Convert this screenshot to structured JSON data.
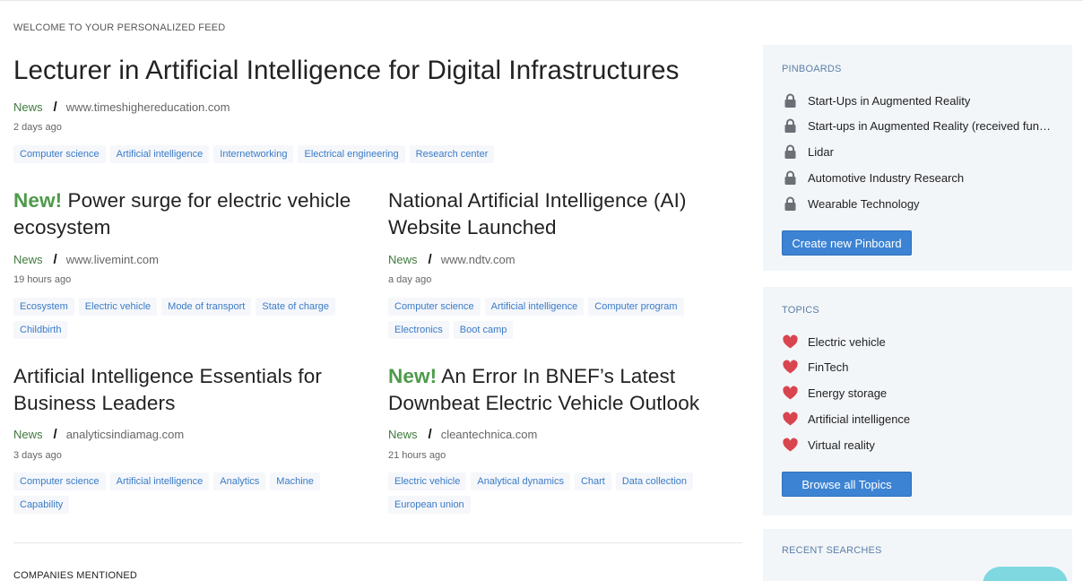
{
  "feed": {
    "welcome": "WELCOME TO YOUR PERSONALIZED FEED",
    "lead": {
      "title": "Lecturer in Artificial Intelligence for Digital Infrastructures",
      "type": "News",
      "source": "www.timeshighereducation.com",
      "age": "2 days ago",
      "tags": [
        "Computer science",
        "Artificial intelligence",
        "Internetworking",
        "Electrical engineering",
        "Research center"
      ]
    },
    "cards": [
      {
        "new_label": "New!",
        "title": "Power surge for electric vehicle ecosystem",
        "type": "News",
        "source": "www.livemint.com",
        "age": "19 hours ago",
        "tags": [
          "Ecosystem",
          "Electric vehicle",
          "Mode of transport",
          "State of charge",
          "Childbirth"
        ]
      },
      {
        "new_label": "",
        "title": "National Artificial Intelligence (AI) Website Launched",
        "type": "News",
        "source": "www.ndtv.com",
        "age": "a day ago",
        "tags": [
          "Computer science",
          "Artificial intelligence",
          "Computer program",
          "Electronics",
          "Boot camp"
        ]
      },
      {
        "new_label": "",
        "title": "Artificial Intelligence Essentials for Business Leaders",
        "type": "News",
        "source": "analyticsindiamag.com",
        "age": "3 days ago",
        "tags": [
          "Computer science",
          "Artificial intelligence",
          "Analytics",
          "Machine",
          "Capability"
        ]
      },
      {
        "new_label": "New!",
        "title": "An Error In BNEF’s Latest Downbeat Electric Vehicle Outlook",
        "type": "News",
        "source": "cleantechnica.com",
        "age": "21 hours ago",
        "tags": [
          "Electric vehicle",
          "Analytical dynamics",
          "Chart",
          "Data collection",
          "European union"
        ]
      }
    ],
    "companies_heading": "COMPANIES MENTIONED"
  },
  "sidebar": {
    "pinboards": {
      "title": "PINBOARDS",
      "icon": "lock-icon",
      "items": [
        "Start-Ups in Augmented Reality",
        "Start-ups in Augmented Reality (received funding)",
        "Lidar",
        "Automotive Industry Research",
        "Wearable Technology"
      ],
      "button": "Create new Pinboard"
    },
    "topics": {
      "title": "TOPICS",
      "icon": "heart-icon",
      "items": [
        "Electric vehicle",
        "FinTech",
        "Energy storage",
        "Artificial intelligence",
        "Virtual reality"
      ],
      "button": "Browse all Topics"
    },
    "recent_searches": {
      "title": "RECENT SEARCHES"
    }
  },
  "colors": {
    "accent_blue": "#3d83d4",
    "news_green": "#3f7a3d",
    "new_green": "#4e9a4b",
    "heart_red": "#d9454f",
    "lock_gray": "#6b6f76",
    "panel_bg": "#f3f6f9"
  }
}
